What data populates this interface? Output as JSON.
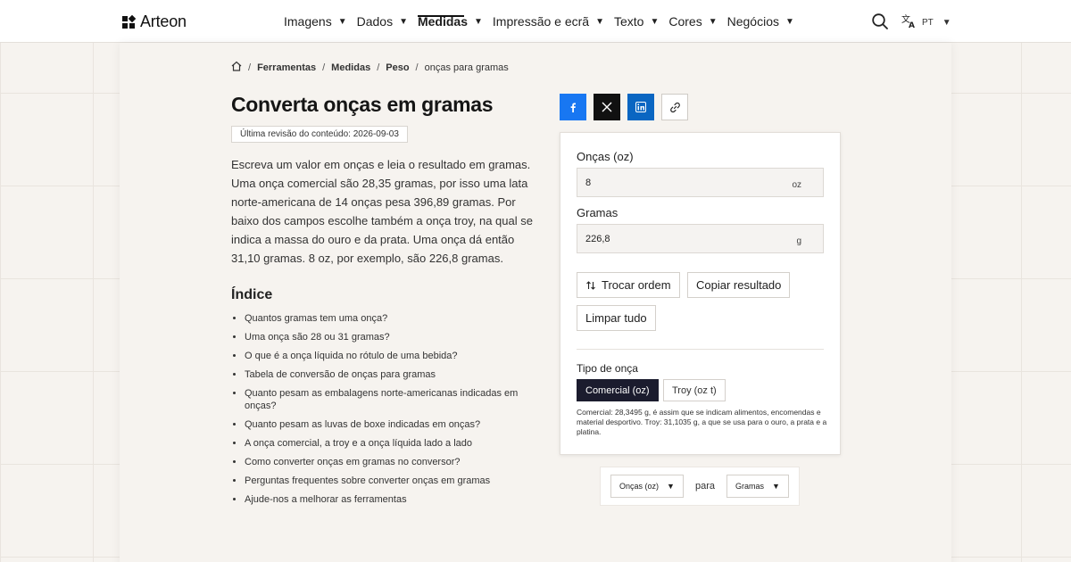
{
  "header": {
    "brand": "Arteon",
    "nav": [
      {
        "label": "Imagens",
        "active": false
      },
      {
        "label": "Dados",
        "active": false
      },
      {
        "label": "Medidas",
        "active": true
      },
      {
        "label": "Impressão e ecrã",
        "active": false
      },
      {
        "label": "Texto",
        "active": false
      },
      {
        "label": "Cores",
        "active": false
      },
      {
        "label": "Negócios",
        "active": false
      }
    ],
    "language": "PT",
    "search_icon": "search-icon",
    "translate_icon": "translate-icon"
  },
  "breadcrumb": {
    "home_icon": "home-icon",
    "items": [
      "Ferramentas",
      "Medidas",
      "Peso"
    ],
    "current": "onças para gramas"
  },
  "page": {
    "title": "Converta onças em gramas",
    "revision": "Última revisão do conteúdo: 2026-09-03",
    "intro": "Escreva um valor em onças e leia o resultado em gramas. Uma onça comercial são 28,35 gramas, por isso uma lata norte-americana de 14 onças pesa 396,89 gramas. Por baixo dos campos escolhe também a onça troy, na qual se indica a massa do ouro e da prata. Uma onça dá então 31,10 gramas. 8 oz, por exemplo, são 226,8 gramas.",
    "toc_title": "Índice",
    "toc": [
      "Quantos gramas tem uma onça?",
      "Uma onça são 28 ou 31 gramas?",
      "O que é a onça líquida no rótulo de uma bebida?",
      "Tabela de conversão de onças para gramas",
      "Quanto pesam as embalagens norte-americanas indicadas em onças?",
      "Quanto pesam as luvas de boxe indicadas em onças?",
      "A onça comercial, a troy e a onça líquida lado a lado",
      "Como converter onças em gramas no conversor?",
      "Perguntas frequentes sobre converter onças em gramas",
      "Ajude-nos a melhorar as ferramentas"
    ]
  },
  "share": {
    "facebook_icon": "facebook-icon",
    "x_icon": "x-icon",
    "linkedin_icon": "linkedin-icon",
    "link_icon": "link-icon",
    "colors": {
      "facebook": "#1877f2",
      "x": "#111111",
      "linkedin": "#0a66c2"
    }
  },
  "converter": {
    "from_label": "Onças (oz)",
    "from_value": "8",
    "from_unit": "oz",
    "to_label": "Gramas",
    "to_value": "226,8",
    "to_unit": "g",
    "swap_label": "Trocar ordem",
    "copy_label": "Copiar resultado",
    "clear_label": "Limpar tudo",
    "type_label": "Tipo de onça",
    "type_options": [
      "Comercial (oz)",
      "Troy (oz t)"
    ],
    "type_selected": "Comercial (oz)",
    "type_note": "Comercial: 28,3495 g, é assim que se indicam alimentos, encomendas e material desportivo. Troy: 31,1035 g, a que se usa para o ouro, a prata e a platina.",
    "accent": "#1b1c2e"
  },
  "unit_row": {
    "from_select": "Onças (oz)",
    "connector": "para",
    "to_select": "Gramas"
  }
}
